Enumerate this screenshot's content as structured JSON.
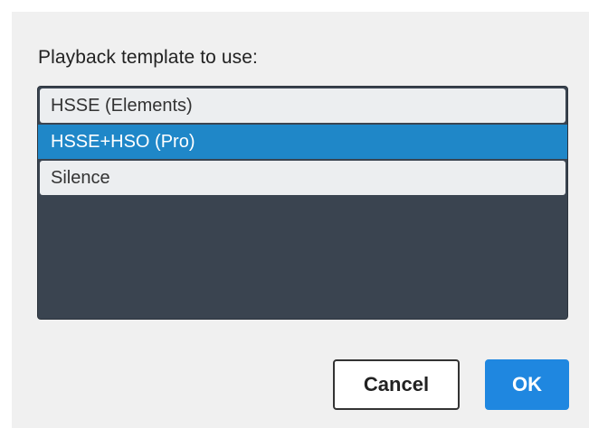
{
  "dialog": {
    "prompt": "Playback template to use:",
    "templates": [
      {
        "label": "HSSE (Elements)",
        "selected": false
      },
      {
        "label": "HSSE+HSO (Pro)",
        "selected": true
      },
      {
        "label": "Silence",
        "selected": false
      }
    ],
    "cancel_label": "Cancel",
    "ok_label": "OK"
  },
  "colors": {
    "list_background": "#3a4450",
    "selection": "#1f87c8",
    "ok_button": "#1f87e0"
  }
}
